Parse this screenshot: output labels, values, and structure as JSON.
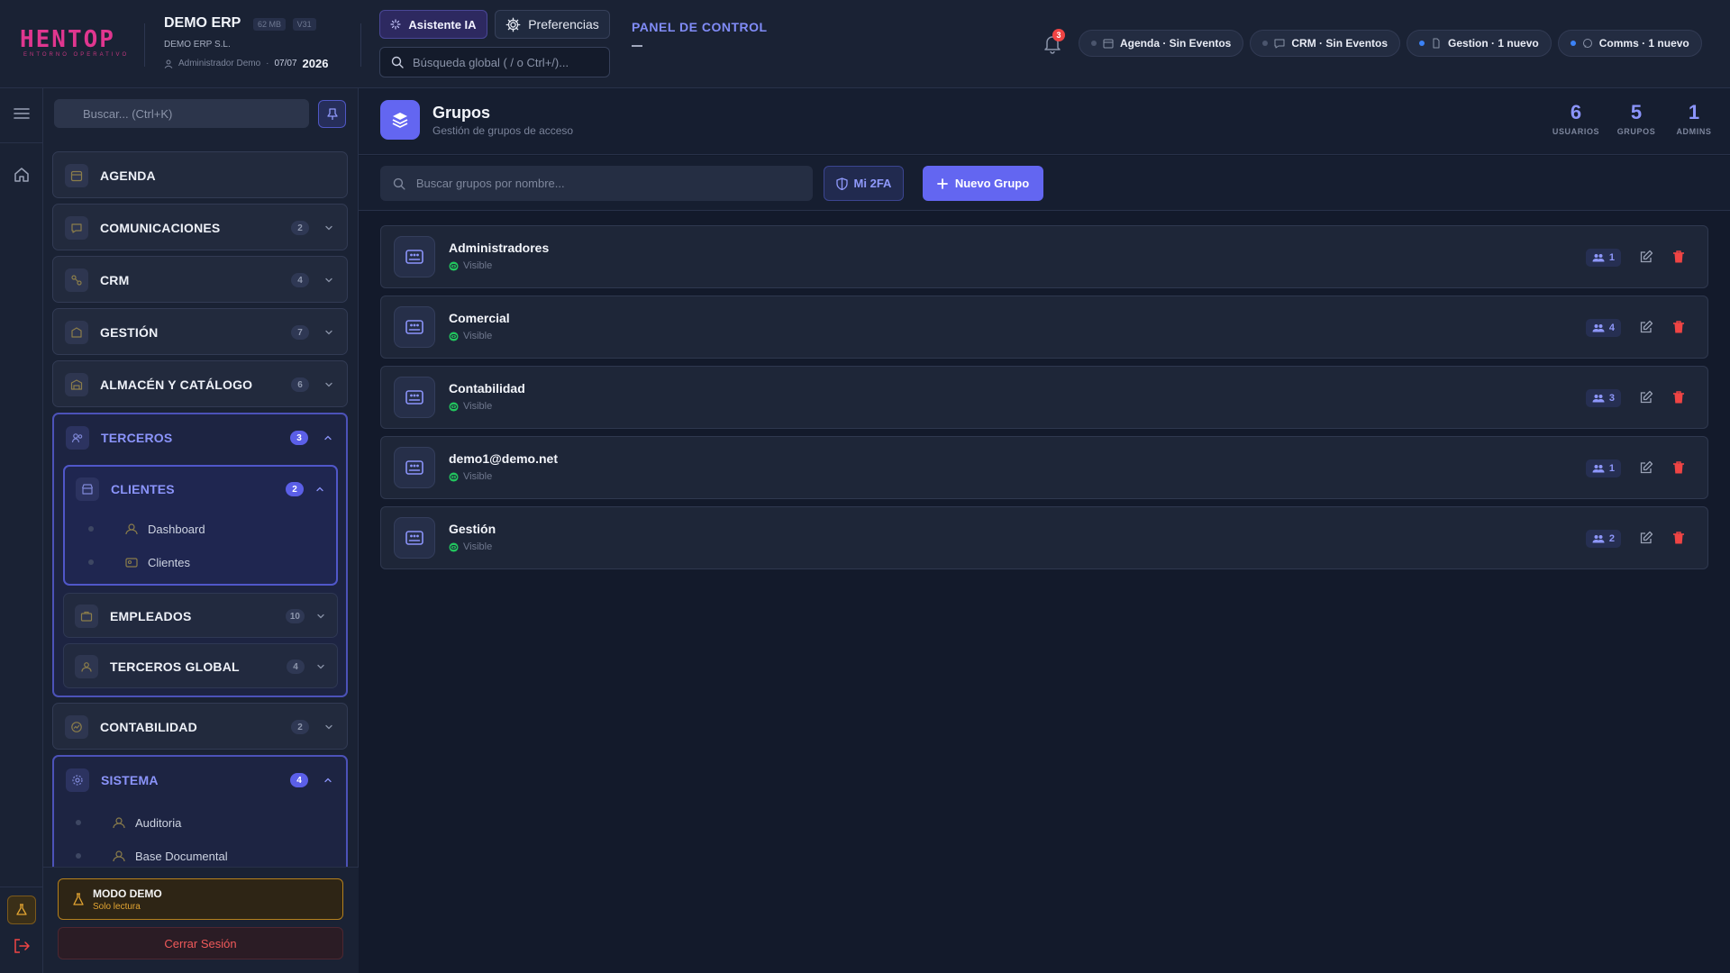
{
  "header": {
    "brand": "HENTOP",
    "brand_sub": "ENTORNO OPERATIVO",
    "company_name": "DEMO ERP",
    "memory": "62 MB",
    "version": "V31",
    "company_legal": "DEMO ERP S.L.",
    "user": "Administrador Demo",
    "date": "07/07",
    "year": "2026",
    "ai_button": "Asistente IA",
    "preferences_button": "Preferencias",
    "global_search_placeholder": "Búsqueda global ( / o Ctrl+/)...",
    "panel_title": "PANEL DE CONTROL",
    "notifications_count": "3",
    "chips": [
      {
        "label": "Agenda · Sin Eventos",
        "active": false,
        "icon": "calendar-icon"
      },
      {
        "label": "CRM · Sin Eventos",
        "active": false,
        "icon": "chat-icon"
      },
      {
        "label": "Gestion · 1 nuevo",
        "active": true,
        "icon": "document-icon"
      },
      {
        "label": "Comms · 1 nuevo",
        "active": true,
        "icon": "message-icon"
      }
    ]
  },
  "sidebar": {
    "search_placeholder": "Buscar... (Ctrl+K)",
    "sections": [
      {
        "label": "AGENDA",
        "count": ""
      },
      {
        "label": "COMUNICACIONES",
        "count": "2"
      },
      {
        "label": "CRM",
        "count": "4"
      },
      {
        "label": "GESTIÓN",
        "count": "7"
      },
      {
        "label": "ALMACÉN Y CATÁLOGO",
        "count": "6"
      },
      {
        "label": "TERCEROS",
        "count": "3"
      },
      {
        "label": "CONTABILIDAD",
        "count": "2"
      },
      {
        "label": "SISTEMA",
        "count": "4"
      }
    ],
    "terceros_sub": [
      {
        "label": "CLIENTES",
        "count": "2"
      },
      {
        "label": "EMPLEADOS",
        "count": "10"
      },
      {
        "label": "TERCEROS GLOBAL",
        "count": "4"
      }
    ],
    "clientes_items": [
      "Dashboard",
      "Clientes"
    ],
    "sistema_items": [
      "Auditoria",
      "Base Documental"
    ],
    "demo_title": "MODO DEMO",
    "demo_sub": "Solo lectura",
    "logout": "Cerrar Sesión"
  },
  "page": {
    "title": "Grupos",
    "subtitle": "Gestión de grupos de acceso",
    "stats": [
      {
        "value": "6",
        "label": "USUARIOS"
      },
      {
        "value": "5",
        "label": "GRUPOS"
      },
      {
        "value": "1",
        "label": "ADMINS"
      }
    ],
    "search_placeholder": "Buscar grupos por nombre...",
    "btn_2fa": "Mi 2FA",
    "btn_new": "Nuevo Grupo",
    "groups": [
      {
        "name": "Administradores",
        "visibility": "Visible",
        "users": "1"
      },
      {
        "name": "Comercial",
        "visibility": "Visible",
        "users": "4"
      },
      {
        "name": "Contabilidad",
        "visibility": "Visible",
        "users": "3"
      },
      {
        "name": "demo1@demo.net",
        "visibility": "Visible",
        "users": "1"
      },
      {
        "name": "Gestión",
        "visibility": "Visible",
        "users": "2"
      }
    ]
  },
  "colors": {
    "accent": "#6366f1",
    "brand": "#e0368f",
    "danger": "#ef4444",
    "visible": "#22c55e",
    "warning": "#e3a532"
  }
}
